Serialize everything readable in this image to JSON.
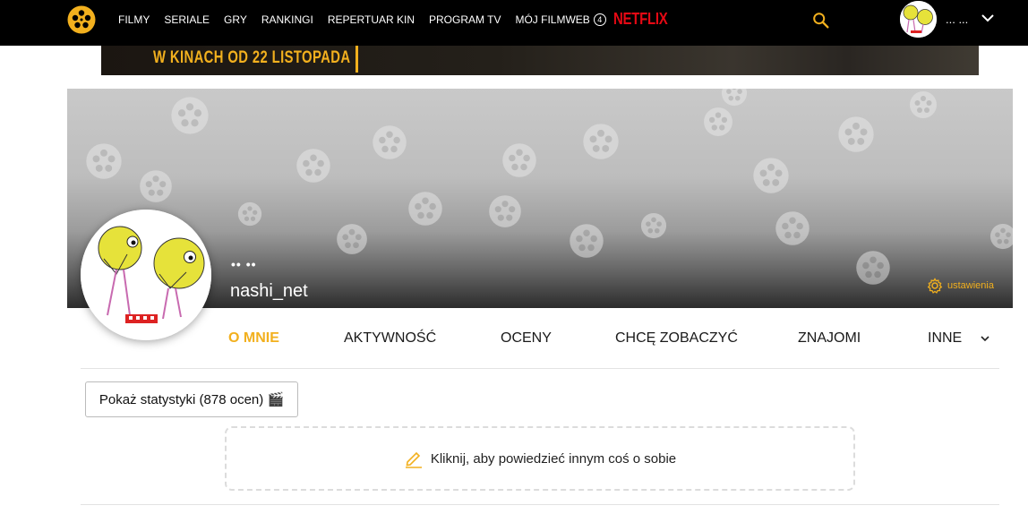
{
  "topbar": {
    "nav_items": [
      "FILMY",
      "SERIALE",
      "GRY",
      "RANKINGI",
      "REPERTUAR KIN",
      "PROGRAM TV"
    ],
    "my_filmweb": "MÓJ FILMWEB",
    "my_filmweb_badge": "4",
    "netflix": "NETFLIX",
    "user_name": "... ..."
  },
  "banner": {
    "text": "W KINACH OD 22 LISTOPADA"
  },
  "profile": {
    "dots": "•• ••",
    "username": "nashi_net",
    "settings_label": "ustawienia"
  },
  "tabs": {
    "about": "O MNIE",
    "activity": "AKTYWNOŚĆ",
    "ratings": "OCENY",
    "want_to_see": "CHCĘ ZOBACZYĆ",
    "friends": "ZNAJOMI",
    "other": "INNE"
  },
  "main": {
    "stats_button": "Pokaż statystyki (878 ocen) 🎬",
    "about_prompt": "Kliknij, aby powiedzieć innym coś o sobie"
  },
  "colors": {
    "accent": "#f2b01e",
    "netflix": "#e50914",
    "topbar": "#000000"
  }
}
